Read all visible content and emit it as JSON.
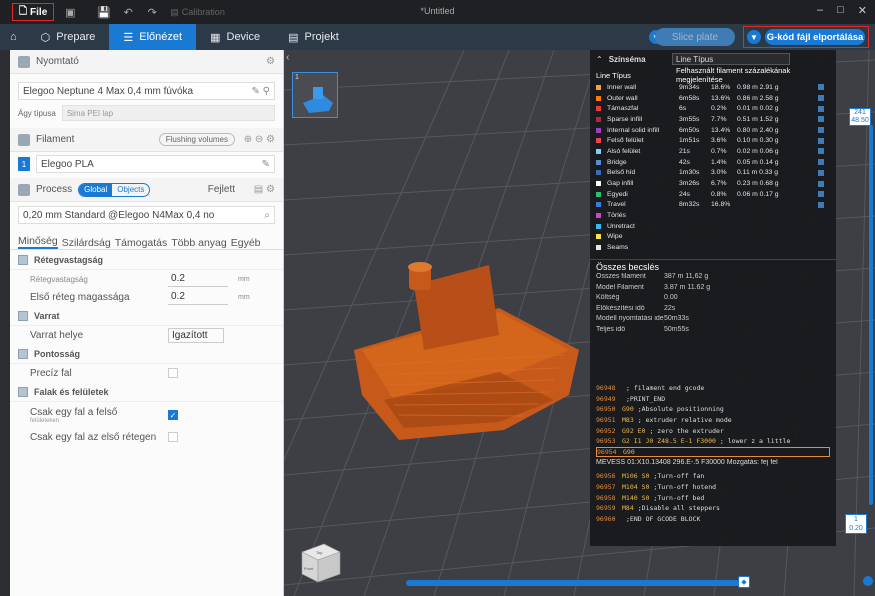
{
  "titlebar": {
    "file_label": "File",
    "calibration_label": "Calibration",
    "window_title": "*Untitled",
    "minimize": "–",
    "maximize": "□",
    "close": "✕"
  },
  "tabs": {
    "prepare": "Prepare",
    "preview": "Előnézet",
    "device": "Device",
    "project": "Projekt",
    "slice_plate": "Slice plate",
    "export_gcode": "G-kód fájl elportálása"
  },
  "left": {
    "printer_header": "Nyomtató",
    "printer_value": "Elegoo Neptune 4 Max 0,4 mm fúvóka",
    "bed_type_label": "Ágy típusa",
    "bed_type_value": "Sima PEI lap",
    "filament_header": "Filament",
    "flushing_volumes": "Flushing volumes",
    "filament_index": "1",
    "filament_value": "Elegoo PLA",
    "process_header": "Process",
    "process_global": "Global",
    "process_objects": "Objects",
    "process_advanced": "Fejlett",
    "process_value": "0,20 mm Standard @Elegoo N4Max 0,4 no",
    "process_tabs": [
      "Minőség",
      "Szilárdság",
      "Támogatás",
      "Több anyag",
      "Egyéb"
    ],
    "cat_layer": "Rétegvastagság",
    "layer_height_label": "Rétegvastagság",
    "layer_height_value": "0.2",
    "first_layer_label": "Első réteg magassága",
    "first_layer_value": "0.2",
    "unit_mm": "mm",
    "cat_seam": "Varrat",
    "seam_pos_label": "Varrat helye",
    "seam_pos_value": "Igazított",
    "cat_precision": "Pontosság",
    "precise_wall_label": "Precíz fal",
    "cat_walls": "Falak és felületek",
    "only_one_wall_label": "Csak egy fal a felső",
    "only_one_wall_sub": "felületeken",
    "only_one_wall_first_label": "Csak egy fal az első rétegen"
  },
  "viewport": {
    "plate_number": "1",
    "slider_top": "241\n48.50",
    "slider_bottom": "1\n0.20",
    "cube_top": "Top",
    "cube_front": "Front"
  },
  "legend": {
    "title": "Színséma",
    "scheme_value": "Line Típus",
    "col_type": "Line Típus",
    "col_usage": "Felhasznált filament százalékának megjelenítése",
    "rows": [
      {
        "name": "Inner wall",
        "time": "9m34s",
        "pct": "18.6%",
        "usage": "0.98 m 2.91 g",
        "color": "#f4a23c"
      },
      {
        "name": "Outer wall",
        "time": "6m58s",
        "pct": "13.6%",
        "usage": "0.86 m 2.58 g",
        "color": "#ff7a00"
      },
      {
        "name": "Támaszfal",
        "time": "6s",
        "pct": "0.2%",
        "usage": "0.01 m 0.02 g",
        "color": "#e63a3a"
      },
      {
        "name": "Sparse infill",
        "time": "3m55s",
        "pct": "7.7%",
        "usage": "0.51 m 1.52 g",
        "color": "#b0283a"
      },
      {
        "name": "Internal solid infill",
        "time": "6m50s",
        "pct": "13.4%",
        "usage": "0.80 m 2.40 g",
        "color": "#9b3fbf"
      },
      {
        "name": "Felső felület",
        "time": "1m51s",
        "pct": "3.6%",
        "usage": "0.10 m 0.30 g",
        "color": "#e8454d"
      },
      {
        "name": "Alsó felület",
        "time": "21s",
        "pct": "0.7%",
        "usage": "0.02 m 0.06 g",
        "color": "#7bd1f5"
      },
      {
        "name": "Bridge",
        "time": "42s",
        "pct": "1.4%",
        "usage": "0.05 m 0.14 g",
        "color": "#5a8ccf"
      },
      {
        "name": "Belső híd",
        "time": "1m30s",
        "pct": "3.0%",
        "usage": "0.11 m 0.33 g",
        "color": "#3a6db0"
      },
      {
        "name": "Gap infill",
        "time": "3m26s",
        "pct": "6.7%",
        "usage": "0.23 m 0.68 g",
        "color": "#ffffff"
      },
      {
        "name": "Egyedi",
        "time": "24s",
        "pct": "0.8%",
        "usage": "0.06 m 0.17 g",
        "color": "#2ebd6e"
      },
      {
        "name": "Travel",
        "time": "8m32s",
        "pct": "16.8%",
        "usage": "",
        "color": "#3a7ad8"
      },
      {
        "name": "Törlés",
        "time": "",
        "pct": "",
        "usage": "",
        "color": "#cc44cc"
      },
      {
        "name": "Unretract",
        "time": "",
        "pct": "",
        "usage": "",
        "color": "#33bbee"
      },
      {
        "name": "Wipe",
        "time": "",
        "pct": "",
        "usage": "",
        "color": "#ffe14d"
      },
      {
        "name": "Seams",
        "time": "",
        "pct": "",
        "usage": "",
        "color": "#e6e6e6"
      }
    ],
    "summary_title": "Összes becslés",
    "summary": [
      {
        "k": "Összes filament",
        "v": "387 m   11,62 g"
      },
      {
        "k": "Model Filament",
        "v": "3.87 m   11.62 g"
      },
      {
        "k": "Költség",
        "v": "0.00"
      },
      {
        "k": "Előkészítési idő",
        "v": "22s"
      },
      {
        "k": "Modell nyomtatási ideje",
        "v": "50m33s"
      },
      {
        "k": "Teljes idő",
        "v": "50m55s"
      }
    ],
    "gcode": [
      {
        "ln": "96948",
        "cmd": "",
        "text": "; filament end gcode"
      },
      {
        "ln": "96949",
        "cmd": "",
        "text": ";PRINT_END"
      },
      {
        "ln": "96950",
        "cmd": "G90",
        "text": ";Absolute positionning"
      },
      {
        "ln": "96951",
        "cmd": "M83",
        "text": "; extruder relative mode"
      },
      {
        "ln": "96952",
        "cmd": "G92 E0",
        "text": "; zero the extruder"
      },
      {
        "ln": "96953",
        "cmd": "G2 I1 J0 Z48.5 E-1 F3000",
        "text": "; lower z a little"
      },
      {
        "ln": "96954",
        "cmd": "G90",
        "text": ""
      }
    ],
    "move_line": "MEVESS 01:X10.13408 296.E-.5 F30000 Mozgatás: fej fel",
    "gcode2": [
      {
        "ln": "96956",
        "cmd": "M106 S0",
        "text": ";Turn-off fan"
      },
      {
        "ln": "96957",
        "cmd": "M104 S0",
        "text": ";Turn-off hotend"
      },
      {
        "ln": "96958",
        "cmd": "M140 S0",
        "text": ";Turn-off bed"
      },
      {
        "ln": "96959",
        "cmd": "M84",
        "text": ";Disable all steppers"
      },
      {
        "ln": "96960",
        "cmd": "",
        "text": ";END OF GCODE BLOCK"
      }
    ]
  }
}
